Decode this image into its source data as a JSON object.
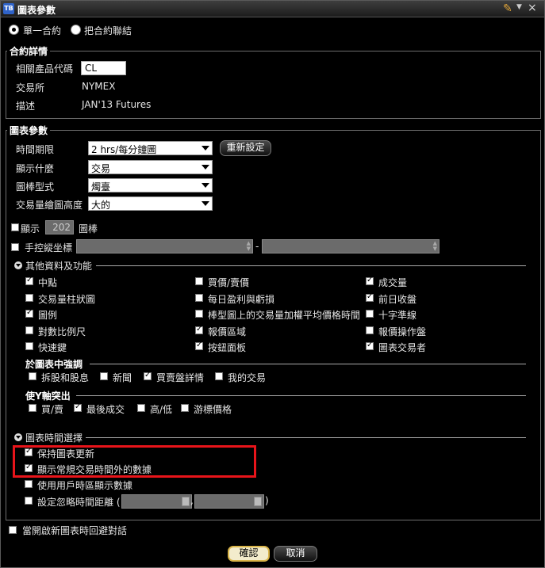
{
  "window": {
    "title": "圖表參數",
    "icon": "TB"
  },
  "mode": {
    "single": "單一合約",
    "linked": "把合約聯結"
  },
  "contract": {
    "legend": "合約詳情",
    "symbol_label": "相關產品代碼",
    "symbol_value": "CL",
    "exchange_label": "交易所",
    "exchange_value": "NYMEX",
    "desc_label": "描述",
    "desc_value": "JAN'13 Futures"
  },
  "params": {
    "legend": "圖表參數",
    "time_label": "時間期限",
    "time_value": "2 hrs/每分鐘圖",
    "reset_label": "重新設定",
    "show_label": "顯示什麼",
    "show_value": "交易",
    "bartype_label": "圖棒型式",
    "bartype_value": "燭臺",
    "volume_label": "交易量繪圖高度",
    "volume_value": "大的",
    "display_label": "顯示",
    "display_count": "202",
    "display_unit": "圖棒",
    "manual_label": "手控縱坐標",
    "range_dash": "-"
  },
  "other": {
    "title": "其他資料及功能",
    "items": [
      {
        "label": "中點",
        "checked": true
      },
      {
        "label": "買價/賣價",
        "checked": false
      },
      {
        "label": "成交量",
        "checked": true
      },
      {
        "label": "交易量柱狀圖",
        "checked": false
      },
      {
        "label": "每日盈利與虧損",
        "checked": false
      },
      {
        "label": "前日收盤",
        "checked": true
      },
      {
        "label": "圖例",
        "checked": true
      },
      {
        "label": "棒型圖上的交易量加權平均價格時間",
        "checked": false
      },
      {
        "label": "十字準線",
        "checked": false
      },
      {
        "label": "對數比例尺",
        "checked": false
      },
      {
        "label": "報價區域",
        "checked": true
      },
      {
        "label": "報價操作盤",
        "checked": false
      },
      {
        "label": "快速鍵",
        "checked": false
      },
      {
        "label": "按鈕面板",
        "checked": true
      },
      {
        "label": "圖表交易者",
        "checked": true
      }
    ]
  },
  "highlight": {
    "title": "於圖表中強調",
    "items": [
      {
        "label": "拆股和股息",
        "checked": false
      },
      {
        "label": "新聞",
        "checked": false
      },
      {
        "label": "買賣盤詳情",
        "checked": true
      },
      {
        "label": "我的交易",
        "checked": false
      }
    ]
  },
  "yaxis": {
    "title": "使Y軸突出",
    "items": [
      {
        "label": "買/賣",
        "checked": false
      },
      {
        "label": "最後成交",
        "checked": true
      },
      {
        "label": "高/低",
        "checked": false
      },
      {
        "label": "游標價格",
        "checked": false
      }
    ]
  },
  "timesel": {
    "title": "圖表時間選擇",
    "items": [
      {
        "label": "保持圖表更新",
        "checked": true
      },
      {
        "label": "顯示常規交易時間外的數據",
        "checked": true
      },
      {
        "label": "使用用戶時區顯示數據",
        "checked": false
      },
      {
        "label": "設定忽略時間距離 (",
        "checked": false
      }
    ],
    "comma": ",",
    "close_paren": ")"
  },
  "footer": {
    "avoid_label": "當開啟新圖表時回避對話",
    "ok": "確認",
    "cancel": "取消"
  }
}
